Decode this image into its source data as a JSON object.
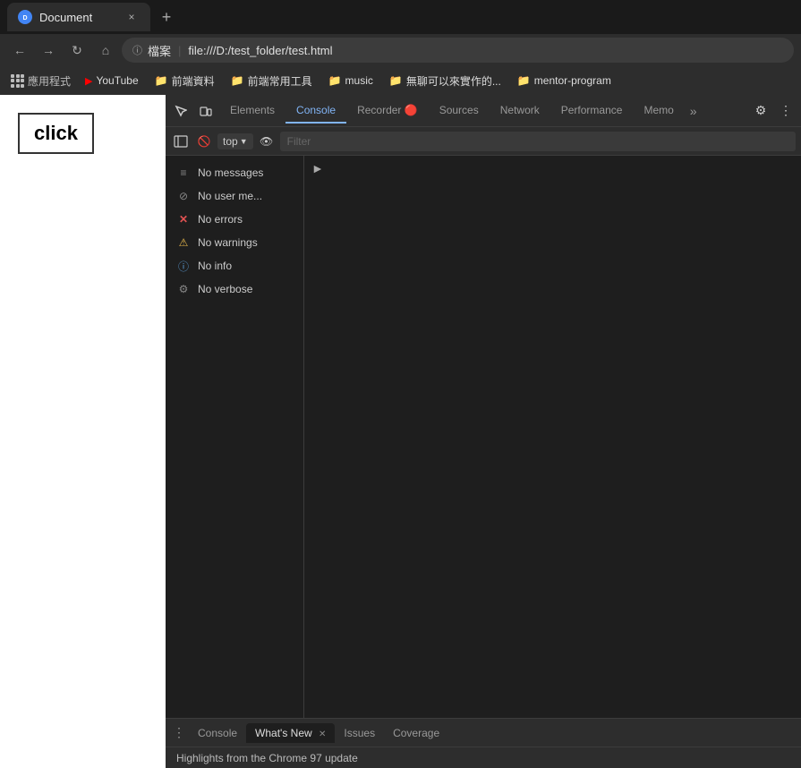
{
  "browser": {
    "title": "Document",
    "tab_close": "×",
    "new_tab": "+",
    "url_label": "檔案",
    "url_separator": "|",
    "url_path": "file:///D:/test_folder/test.html"
  },
  "bookmarks": {
    "apps_label": "應用程式",
    "items": [
      {
        "id": "youtube",
        "label": "YouTube",
        "icon_type": "yt"
      },
      {
        "id": "frontend-data",
        "label": "前端資料",
        "icon_type": "folder-yellow"
      },
      {
        "id": "frontend-tools",
        "label": "前端常用工具",
        "icon_type": "folder-yellow"
      },
      {
        "id": "music",
        "label": "music",
        "icon_type": "folder-yellow"
      },
      {
        "id": "boring",
        "label": "無聊可以來實作的...",
        "icon_type": "folder-yellow"
      },
      {
        "id": "mentor",
        "label": "mentor-program",
        "icon_type": "folder-yellow"
      }
    ]
  },
  "page": {
    "click_button_label": "click"
  },
  "devtools": {
    "tabs": [
      {
        "id": "elements",
        "label": "Elements",
        "active": false
      },
      {
        "id": "console",
        "label": "Console",
        "active": true
      },
      {
        "id": "recorder",
        "label": "Recorder 🔴",
        "active": false
      },
      {
        "id": "sources",
        "label": "Sources",
        "active": false
      },
      {
        "id": "network",
        "label": "Network",
        "active": false
      },
      {
        "id": "performance",
        "label": "Performance",
        "active": false
      },
      {
        "id": "memory",
        "label": "Memo",
        "active": false
      }
    ],
    "console": {
      "context": "top",
      "filter_placeholder": "Filter",
      "filter_items": [
        {
          "id": "no-messages",
          "icon": "≡",
          "icon_class": "icon-messages",
          "label": "No messages"
        },
        {
          "id": "no-user-messages",
          "icon": "⊘",
          "icon_class": "icon-user",
          "label": "No user me..."
        },
        {
          "id": "no-errors",
          "icon": "✕",
          "icon_class": "icon-error",
          "label": "No errors"
        },
        {
          "id": "no-warnings",
          "icon": "⚠",
          "icon_class": "icon-warning",
          "label": "No warnings"
        },
        {
          "id": "no-info",
          "icon": "ℹ",
          "icon_class": "icon-info",
          "label": "No info"
        },
        {
          "id": "no-verbose",
          "icon": "⚙",
          "icon_class": "icon-verbose",
          "label": "No verbose"
        }
      ]
    },
    "bottom_tabs": [
      {
        "id": "console-bottom",
        "label": "Console",
        "active": false,
        "closeable": false
      },
      {
        "id": "whats-new",
        "label": "What's New",
        "active": true,
        "closeable": true
      },
      {
        "id": "issues",
        "label": "Issues",
        "active": false,
        "closeable": false
      },
      {
        "id": "coverage",
        "label": "Coverage",
        "active": false,
        "closeable": false
      }
    ],
    "status_bar": {
      "text": "Highlights from the Chrome 97 update"
    }
  }
}
